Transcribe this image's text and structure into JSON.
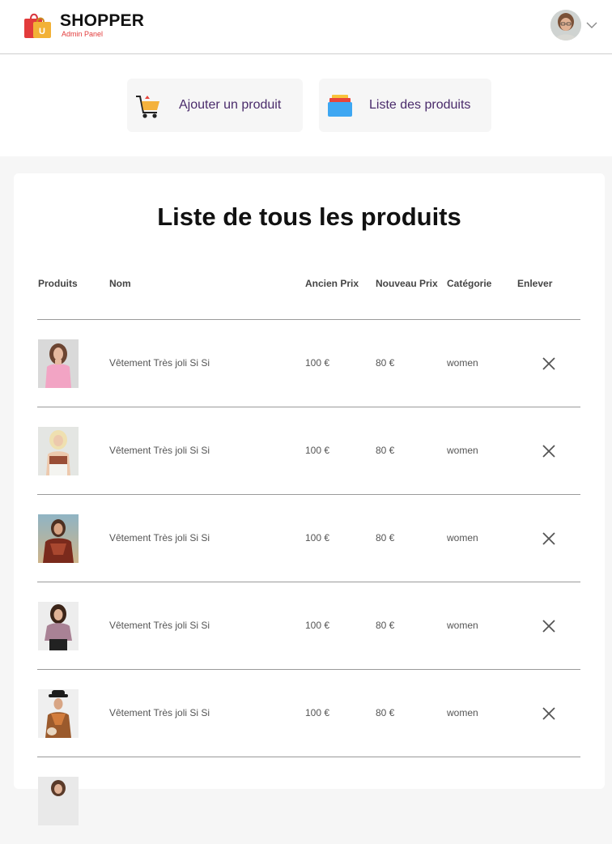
{
  "navbar": {
    "logo_title": "SHOPPER",
    "logo_subtitle": "Admin Panel",
    "logo_bag_letter": "U",
    "profile_icon": "chevron-down-icon"
  },
  "sidebar": {
    "add_label": "Ajouter un produit",
    "list_label": "Liste des produits"
  },
  "list": {
    "title": "Liste de tous les produits",
    "columns": {
      "products": "Produits",
      "name": "Nom",
      "old_price": "Ancien Prix",
      "new_price": "Nouveau Prix",
      "category": "Catégorie",
      "remove": "Enlever"
    },
    "rows": [
      {
        "name": "Vêtement Très joli Si Si",
        "old_price": "100 €",
        "new_price": "80 €",
        "category": "women"
      },
      {
        "name": "Vêtement Très joli Si Si",
        "old_price": "100 €",
        "new_price": "80 €",
        "category": "women"
      },
      {
        "name": "Vêtement Très joli Si Si",
        "old_price": "100 €",
        "new_price": "80 €",
        "category": "women"
      },
      {
        "name": "Vêtement Très joli Si Si",
        "old_price": "100 €",
        "new_price": "80 €",
        "category": "women"
      },
      {
        "name": "Vêtement Très joli Si Si",
        "old_price": "100 €",
        "new_price": "80 €",
        "category": "women"
      }
    ]
  },
  "colors": {
    "accent_text": "#4a2b6b",
    "logo_red": "#e23b3b",
    "divider": "#9a9a9a"
  }
}
